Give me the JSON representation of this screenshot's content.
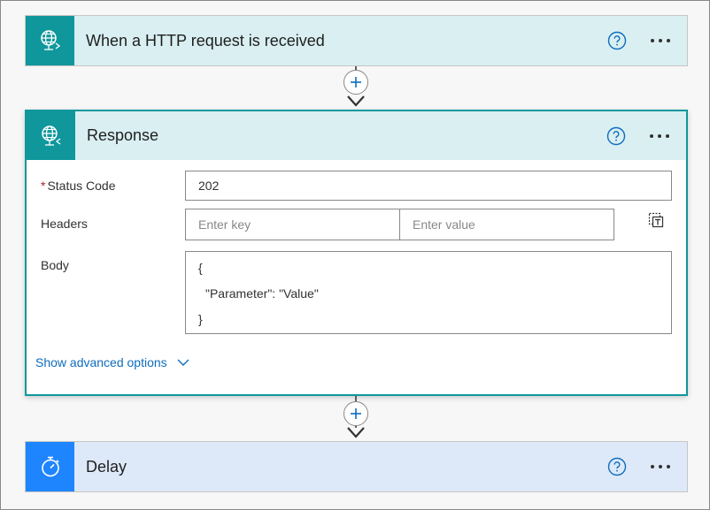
{
  "flow": {
    "trigger": {
      "title": "When a HTTP request is received",
      "icon": "globe-request-icon"
    },
    "response": {
      "title": "Response",
      "icon": "globe-response-icon",
      "status_code": {
        "label": "Status Code",
        "required_marker": "*",
        "value": "202"
      },
      "headers": {
        "label": "Headers",
        "key_placeholder": "Enter key",
        "value_placeholder": "Enter value"
      },
      "body": {
        "label": "Body",
        "lines": [
          "{",
          "\"Parameter\": \"Value\"",
          "}"
        ]
      },
      "advanced_label": "Show advanced options"
    },
    "delay": {
      "title": "Delay",
      "icon": "stopwatch-icon"
    }
  },
  "colors": {
    "teal": "#0f979c",
    "teal_header": "#d9eff2",
    "blue": "#1f85ff",
    "blue_header": "#dde9f9",
    "link": "#0f6cbd",
    "required": "#a4262c"
  }
}
